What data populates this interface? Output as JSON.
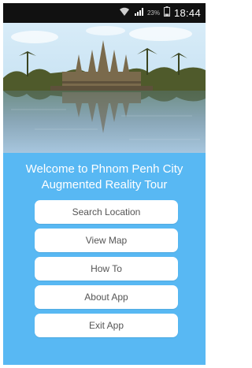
{
  "status_bar": {
    "battery_percent": "23%",
    "time": "18:44",
    "icons": [
      "wifi-icon",
      "signal-icon",
      "battery-icon"
    ]
  },
  "hero": {
    "image": "angkor-wat-reflection-photo"
  },
  "welcome": {
    "line1": "Welcome to Phnom Penh City",
    "line2": "Augmented Reality Tour"
  },
  "menu": {
    "buttons": [
      {
        "label": "Search Location"
      },
      {
        "label": "View Map"
      },
      {
        "label": "How To"
      },
      {
        "label": "About App"
      },
      {
        "label": "Exit App"
      }
    ]
  },
  "colors": {
    "background": "#58b8f3",
    "status_bar": "#111111",
    "button": "#ffffff",
    "button_text": "#555555"
  }
}
